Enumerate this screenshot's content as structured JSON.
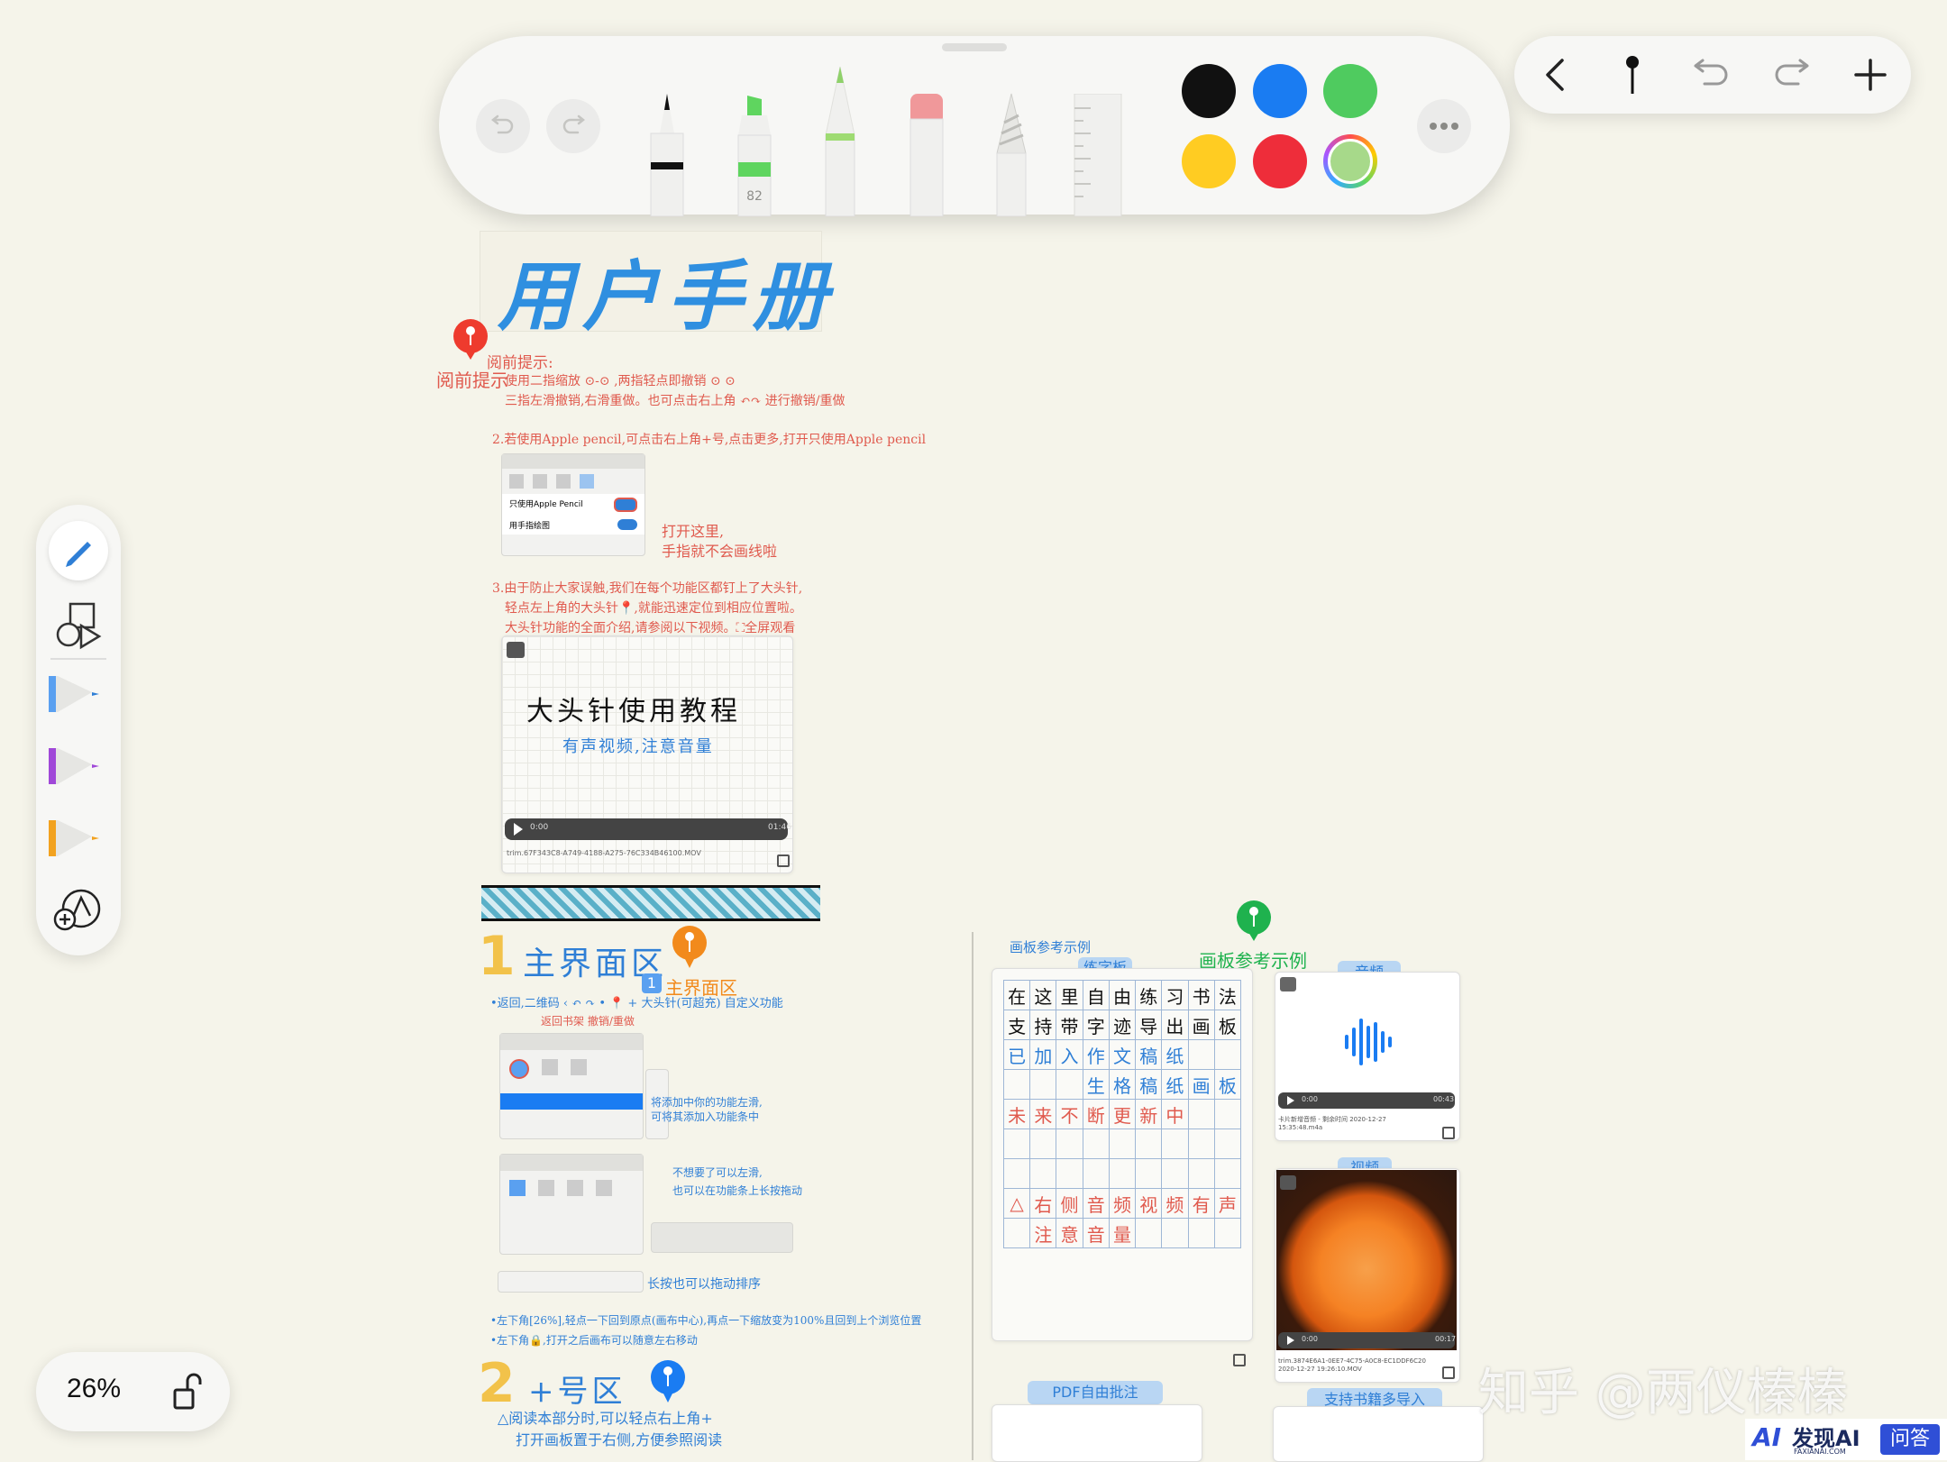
{
  "toolbar": {
    "pen_width_label": "82",
    "colors": [
      "#111111",
      "#1a7cf2",
      "#4fcb5f",
      "#ffcc22",
      "#ee2d3a",
      "#a7d98a"
    ]
  },
  "top_controls": {
    "icons": [
      "chevron-left-icon",
      "pin-icon",
      "undo-icon",
      "redo-icon",
      "plus-icon"
    ]
  },
  "sidebar": {
    "tools": [
      "pen-tool-icon",
      "shapes-icon",
      "blue-pen-icon",
      "purple-pen-icon",
      "orange-pen-icon",
      "add-tool-icon"
    ]
  },
  "zoom": {
    "value": "26%"
  },
  "doc": {
    "title": "用户手册",
    "pin_read_first": "阅前提示",
    "tips_heading": "阅前提示:",
    "tip1a": "使用二指缩放 ⊙-⊙ ,两指轻点即撤销 ⊙ ⊙",
    "tip1b": "三指左滑撤销,右滑重做。也可点击右上角 ↶↷ 进行撤销/重做",
    "tip2": "2.若使用Apple pencil,可点击右上角+号,点击更多,打开只使用Apple pencil",
    "menu_pencil_only": "只使用Apple Pencil",
    "menu_finger_draw": "用手指绘图",
    "annot_turn_on": "打开这里,",
    "annot_finger": "手指就不会画线啦",
    "tip3a": "3.由于防止大家误触,我们在每个功能区都钉上了大头针,",
    "tip3b": "轻点左上角的大头针📍,就能迅速定位到相应位置啦。",
    "tip3c": "大头针功能的全面介绍,请参阅以下视频。⛶全屏观看",
    "video_title": "大头针使用教程",
    "video_subtitle": "有声视频,注意音量",
    "video_time_start": "0:00",
    "video_time_end": "01:46",
    "video_filename": "trim.67F343C8-A749-4188-A275-76C334B46100.MOV",
    "sec1_num": "1",
    "sec1_title": "主界面区",
    "pin_main": "主界面区",
    "sec1_line1": "•返回,二维码 ‹ ↶ ↷ • 📍 + 大头针(可超充) 自定义功能",
    "sec1_line2": "返回书架  撤销/重做",
    "sec1_annot1": "将添加中你的功能左滑,",
    "sec1_annot2": "可将其添加入功能条中",
    "sec1_annot3": "不想要了可以左滑,",
    "sec1_annot4": "也可以在功能条上长按拖动",
    "sec1_drag": "长按也可以拖动排序",
    "sec1_note1": "•左下角[26%],轻点一下回到原点(画布中心),再点一下缩放变为100%且回到上个浏览位置",
    "sec1_note2": "•左下角🔒,打开之后画布可以随意左右移动",
    "sec2_num": "2",
    "sec2_title": "+号区",
    "sec2_line1": "△阅读本部分时,可以轻点右上角+",
    "sec2_line2": "打开画板置于右侧,方便参照阅读",
    "right_ref": "画板参考示例",
    "pin_canvas": "画板参考示例",
    "tab_practice": "练字板",
    "tab_audio": "音频",
    "tab_video": "视频",
    "tab_pdf": "PDF自由批注",
    "tab_multi": "支持书籍多导入",
    "grid_rows": [
      [
        "在",
        "这",
        "里",
        "自",
        "由",
        "练",
        "习",
        "书",
        "法"
      ],
      [
        "支",
        "持",
        "带",
        "字",
        "迹",
        "导",
        "出",
        "画",
        "板"
      ],
      [
        "已",
        "加",
        "入",
        "作",
        "文",
        "稿",
        "纸",
        "",
        " "
      ],
      [
        "",
        "",
        "",
        "生",
        "格",
        "稿",
        "纸",
        "画",
        "板"
      ],
      [
        "未",
        "来",
        "不",
        "断",
        "更",
        "新",
        "中",
        "",
        ""
      ],
      [
        "",
        "",
        "",
        "",
        "",
        "",
        "",
        "",
        ""
      ],
      [
        "",
        "",
        "",
        "",
        "",
        "",
        "",
        "",
        ""
      ],
      [
        "△",
        "右",
        "侧",
        "音",
        "频",
        "视",
        "频",
        "有",
        "声"
      ],
      [
        "",
        "注",
        "意",
        "音",
        "量",
        "",
        "",
        "",
        ""
      ]
    ],
    "audio_time_start": "0:00",
    "audio_time_end": "00:43",
    "audio_caption": "卡片新增音频 - 剩余时间 2020-12-27 15:35:48.m4a",
    "video2_time_start": "0:00",
    "video2_time_end": "00:17",
    "video2_caption": "trim.3874E6A1-0EE7-4C75-A0C8-EC1DDF6C20 2020-12-27 19:26:10.MOV",
    "watermark": "知乎 @两仪榛榛",
    "brand_logo_text": "发现AI",
    "brand_logo_sub": "FAXIANAI.COM",
    "brand_qa": "问答"
  }
}
